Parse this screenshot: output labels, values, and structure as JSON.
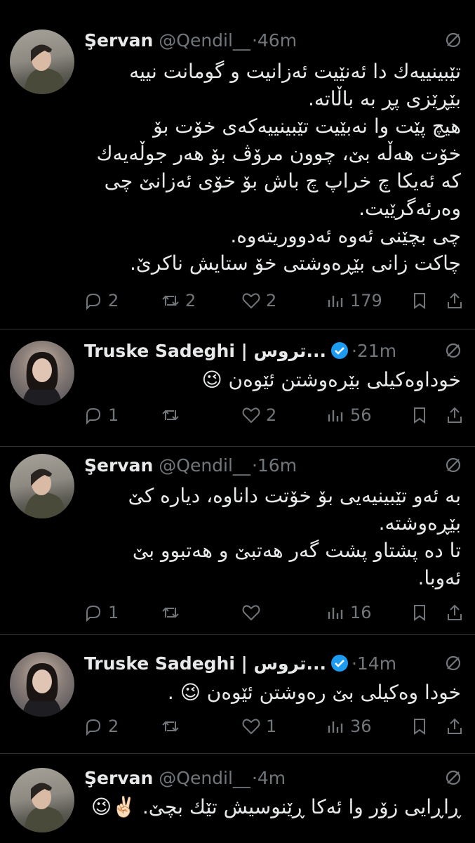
{
  "tweets": [
    {
      "author": "Şervan",
      "handle": "@Qendil__",
      "time": "·46m",
      "lines": [
        "تێبینییەك دا ئەنێیت ئەزانیت و گومانت نییە",
        "بێڕێزی پڕ بە باڵاتە.",
        "هیچ پێت وا نەبێیت تێبینییەکەی خۆت بۆ",
        "خۆت هەڵە بێ، چوون مرۆڤ بۆ هەر جوڵەیەك",
        "کە ئەیکا چ خراپ چ باش بۆ خۆی ئەزانێ چی",
        "وەرئەگرێیت.",
        "چی بچێنی ئەوە ئەدووریتەوە.",
        "چاکت زانی بێڕەوشتی خۆ ستایش ناکرێ."
      ],
      "replies": "2",
      "retweets": "2",
      "likes": "2",
      "views": "179"
    },
    {
      "author": "Truske Sadeghi | تروس...",
      "verified": true,
      "time": "·21m",
      "lines": [
        "خوداوەکیلی بێرەوشتن ئێوەن 😉"
      ],
      "replies": "1",
      "retweets": "",
      "likes": "2",
      "views": "56"
    },
    {
      "author": "Şervan",
      "handle": "@Qendil__",
      "time": "·16m",
      "lines": [
        "بە ئەو تێبینیەیی بۆ خۆتت داناوە، دیارە کێ",
        "بێڕەوشتە.",
        "تا دە پشتاو پشت گەر هەتبێ و هەتبوو بێ",
        "ئەوبا."
      ],
      "replies": "1",
      "retweets": "",
      "likes": "",
      "views": "16"
    },
    {
      "author": "Truske Sadeghi | تروس...",
      "verified": true,
      "time": "·14m",
      "lines": [
        "خودا وەکیلی بێ رەوشتن ئێوەن 😉 ."
      ],
      "replies": "2",
      "retweets": "",
      "likes": "1",
      "views": "36"
    },
    {
      "author": "Şervan",
      "handle": "@Qendil__",
      "time": "·4m",
      "lines": [
        "ڕاڕایی زۆر وا ئەکا ڕێنوسیش تێك بچێ. ✌🏻😉"
      ]
    }
  ],
  "colors": {
    "background": "#000000",
    "text": "#e7e9ea",
    "secondary": "#71767b",
    "verified": "#1d9bf0",
    "divider": "#2f3336"
  },
  "icons": [
    "reply-icon",
    "retweet-icon",
    "like-icon",
    "views-icon",
    "bookmark-icon",
    "share-icon",
    "more-icon",
    "verified-badge-icon"
  ]
}
